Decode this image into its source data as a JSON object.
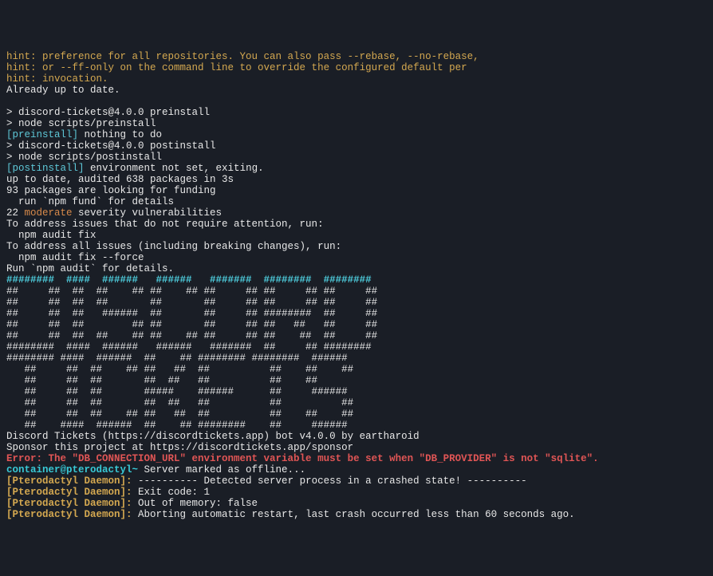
{
  "lines": [
    {
      "segments": [
        {
          "class": "yellow",
          "text": "hint: preference for all repositories. You can also pass --rebase, --no-rebase,"
        }
      ]
    },
    {
      "segments": [
        {
          "class": "yellow",
          "text": "hint: or --ff-only on the command line to override the configured default per"
        }
      ]
    },
    {
      "segments": [
        {
          "class": "yellow",
          "text": "hint: invocation."
        }
      ]
    },
    {
      "segments": [
        {
          "class": "white",
          "text": "Already up to date."
        }
      ]
    },
    {
      "segments": [
        {
          "class": "white",
          "text": ""
        }
      ]
    },
    {
      "segments": [
        {
          "class": "white",
          "text": "> discord-tickets@4.0.0 preinstall"
        }
      ]
    },
    {
      "segments": [
        {
          "class": "white",
          "text": "> node scripts/preinstall"
        }
      ]
    },
    {
      "segments": [
        {
          "class": "cyan",
          "text": "[preinstall]"
        },
        {
          "class": "white",
          "text": " nothing to do"
        }
      ]
    },
    {
      "segments": [
        {
          "class": "white",
          "text": "> discord-tickets@4.0.0 postinstall"
        }
      ]
    },
    {
      "segments": [
        {
          "class": "white",
          "text": "> node scripts/postinstall"
        }
      ]
    },
    {
      "segments": [
        {
          "class": "cyan",
          "text": "[postinstall]"
        },
        {
          "class": "white",
          "text": " environment not set, exiting."
        }
      ]
    },
    {
      "segments": [
        {
          "class": "white",
          "text": "up to date, audited 638 packages in 3s"
        }
      ]
    },
    {
      "segments": [
        {
          "class": "white",
          "text": "93 packages are looking for funding"
        }
      ]
    },
    {
      "segments": [
        {
          "class": "white",
          "text": "  run `npm fund` for details"
        }
      ]
    },
    {
      "segments": [
        {
          "class": "white",
          "text": "22 "
        },
        {
          "class": "orange",
          "text": "moderate"
        },
        {
          "class": "white",
          "text": " severity vulnerabilities"
        }
      ]
    },
    {
      "segments": [
        {
          "class": "white",
          "text": "To address issues that do not require attention, run:"
        }
      ]
    },
    {
      "segments": [
        {
          "class": "white",
          "text": "  npm audit fix"
        }
      ]
    },
    {
      "segments": [
        {
          "class": "white",
          "text": "To address all issues (including breaking changes), run:"
        }
      ]
    },
    {
      "segments": [
        {
          "class": "white",
          "text": "  npm audit fix --force"
        }
      ]
    },
    {
      "segments": [
        {
          "class": "white",
          "text": "Run `npm audit` for details."
        }
      ]
    },
    {
      "segments": [
        {
          "class": "brightcyan",
          "text": "########  ####  ######   ######   #######  ########  ######## "
        }
      ]
    },
    {
      "segments": [
        {
          "class": "white",
          "text": "##     ##  ##  ##    ## ##    ## ##     ## ##     ## ##     ##"
        }
      ]
    },
    {
      "segments": [
        {
          "class": "white",
          "text": "##     ##  ##  ##       ##       ##     ## ##     ## ##     ##"
        }
      ]
    },
    {
      "segments": [
        {
          "class": "white",
          "text": "##     ##  ##   ######  ##       ##     ## ########  ##     ##"
        }
      ]
    },
    {
      "segments": [
        {
          "class": "white",
          "text": "##     ##  ##        ## ##       ##     ## ##   ##   ##     ##"
        }
      ]
    },
    {
      "segments": [
        {
          "class": "white",
          "text": "##     ##  ##  ##    ## ##    ## ##     ## ##    ##  ##     ##"
        }
      ]
    },
    {
      "segments": [
        {
          "class": "white",
          "text": "########  ####  ######   ######   #######  ##     ## ######## "
        }
      ]
    },
    {
      "segments": [
        {
          "class": "white",
          "text": "######## ####  ######  ##    ## ######## ########  ######    "
        }
      ]
    },
    {
      "segments": [
        {
          "class": "white",
          "text": "   ##     ##  ##    ## ##   ##  ##          ##    ##    ##   "
        }
      ]
    },
    {
      "segments": [
        {
          "class": "white",
          "text": "   ##     ##  ##       ##  ##   ##          ##    ##         "
        }
      ]
    },
    {
      "segments": [
        {
          "class": "white",
          "text": "   ##     ##  ##       #####    ######      ##     ######    "
        }
      ]
    },
    {
      "segments": [
        {
          "class": "white",
          "text": "   ##     ##  ##       ##  ##   ##          ##          ##   "
        }
      ]
    },
    {
      "segments": [
        {
          "class": "white",
          "text": "   ##     ##  ##    ## ##   ##  ##          ##    ##    ##   "
        }
      ]
    },
    {
      "segments": [
        {
          "class": "white",
          "text": "   ##    ####  ######  ##    ## ########    ##     ######    "
        }
      ]
    },
    {
      "segments": [
        {
          "class": "white",
          "text": "Discord Tickets (https://discordtickets.app) bot v4.0.0 by eartharoid"
        }
      ]
    },
    {
      "segments": [
        {
          "class": "white",
          "text": "Sponsor this project at https://discordtickets.app/sponsor"
        }
      ]
    },
    {
      "segments": [
        {
          "class": "red-bold",
          "text": "Error: The \"DB_CONNECTION_URL\" environment variable must be set when \"DB_PROVIDER\" is not \"sqlite\"."
        }
      ]
    },
    {
      "segments": [
        {
          "class": "bright-cyan-prompt",
          "text": "container@pterodactyl~"
        },
        {
          "class": "white",
          "text": " Server marked as offline..."
        }
      ]
    },
    {
      "segments": [
        {
          "class": "yellow-bold",
          "text": "[Pterodactyl Daemon]:"
        },
        {
          "class": "white",
          "text": " ---------- Detected server process in a crashed state! ----------"
        }
      ]
    },
    {
      "segments": [
        {
          "class": "yellow-bold",
          "text": "[Pterodactyl Daemon]:"
        },
        {
          "class": "white",
          "text": " Exit code: 1"
        }
      ]
    },
    {
      "segments": [
        {
          "class": "yellow-bold",
          "text": "[Pterodactyl Daemon]:"
        },
        {
          "class": "white",
          "text": " Out of memory: false"
        }
      ]
    },
    {
      "segments": [
        {
          "class": "yellow-bold",
          "text": "[Pterodactyl Daemon]:"
        },
        {
          "class": "white",
          "text": " Aborting automatic restart, last crash occurred less than 60 seconds ago."
        }
      ]
    }
  ]
}
